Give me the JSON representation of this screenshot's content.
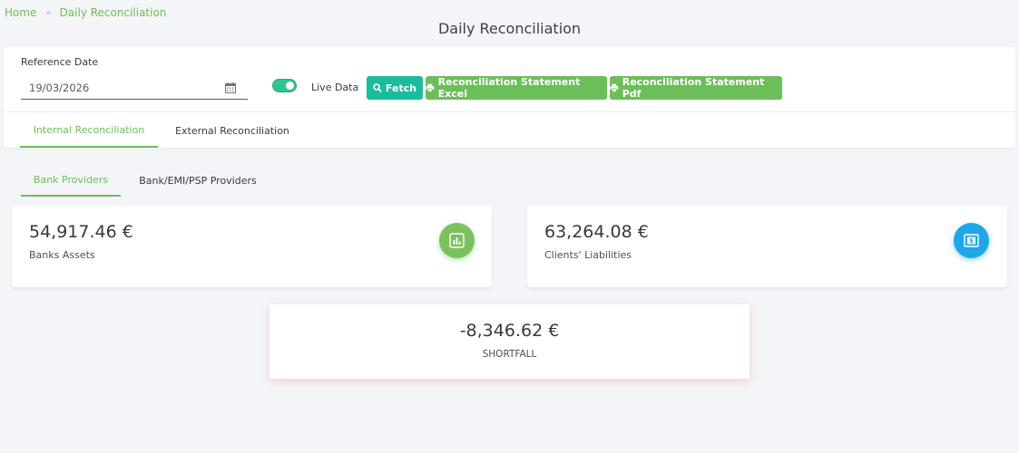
{
  "breadcrumb": {
    "home": "Home",
    "separator": "»",
    "current": "Daily Reconciliation"
  },
  "page_title": "Daily Reconciliation",
  "filters": {
    "reference_date_label": "Reference Date",
    "reference_date_value": "19/03/2026",
    "live_data_label": "Live Data",
    "live_data_enabled": true
  },
  "buttons": {
    "fetch": "Fetch",
    "excel": "Reconciliation Statement Excel",
    "pdf": "Reconciliation Statement Pdf"
  },
  "tabs": [
    {
      "label": "Internal Reconciliation",
      "active": true
    },
    {
      "label": "External Reconciliation",
      "active": false
    }
  ],
  "subtabs": [
    {
      "label": "Bank Providers",
      "active": true
    },
    {
      "label": "Bank/EMI/PSP Providers",
      "active": false
    }
  ],
  "stats": {
    "bank_assets": {
      "value": "54,917.46 €",
      "label": "Banks Assets",
      "icon": "chart-icon"
    },
    "client_liabilities": {
      "value": "63,264.08 €",
      "label": "Clients' Liabilities",
      "icon": "money-icon"
    },
    "shortfall": {
      "value": "-8,346.62 €",
      "label": "SHORTFALL"
    }
  },
  "colors": {
    "accent_green": "#6cbe58",
    "teal": "#1bbc9b",
    "blue": "#1ea7e8",
    "toggle_on": "#34c38f"
  }
}
